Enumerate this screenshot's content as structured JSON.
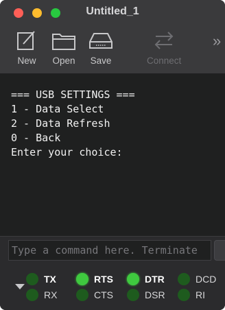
{
  "window": {
    "title": "Untitled_1"
  },
  "toolbar": {
    "items": [
      {
        "label": "New",
        "icon": "new-document-icon",
        "enabled": true
      },
      {
        "label": "Open",
        "icon": "folder-icon",
        "enabled": true
      },
      {
        "label": "Save",
        "icon": "disk-drive-icon",
        "enabled": true
      },
      {
        "label": "Connect",
        "icon": "connect-arrows-icon",
        "enabled": false
      }
    ],
    "overflow_label": "»"
  },
  "terminal": {
    "lines": [
      "=== USB SETTINGS ===",
      "1 - Data Select",
      "2 - Data Refresh",
      "0 - Back",
      "Enter your choice:"
    ]
  },
  "command": {
    "value": "",
    "placeholder": "Type a command here. Terminate"
  },
  "signals": [
    {
      "name": "TX",
      "on": false,
      "bold": true
    },
    {
      "name": "RX",
      "on": false,
      "bold": false
    },
    {
      "name": "RTS",
      "on": true,
      "bold": true
    },
    {
      "name": "CTS",
      "on": false,
      "bold": false
    },
    {
      "name": "DTR",
      "on": true,
      "bold": true
    },
    {
      "name": "DSR",
      "on": false,
      "bold": false
    },
    {
      "name": "DCD",
      "on": false,
      "bold": false
    },
    {
      "name": "RI",
      "on": false,
      "bold": false
    }
  ],
  "colors": {
    "led_on": "#3fc93f",
    "led_off": "#1e5b1e",
    "terminal_bg": "#1f2020",
    "terminal_text": "#f2f2f2"
  }
}
